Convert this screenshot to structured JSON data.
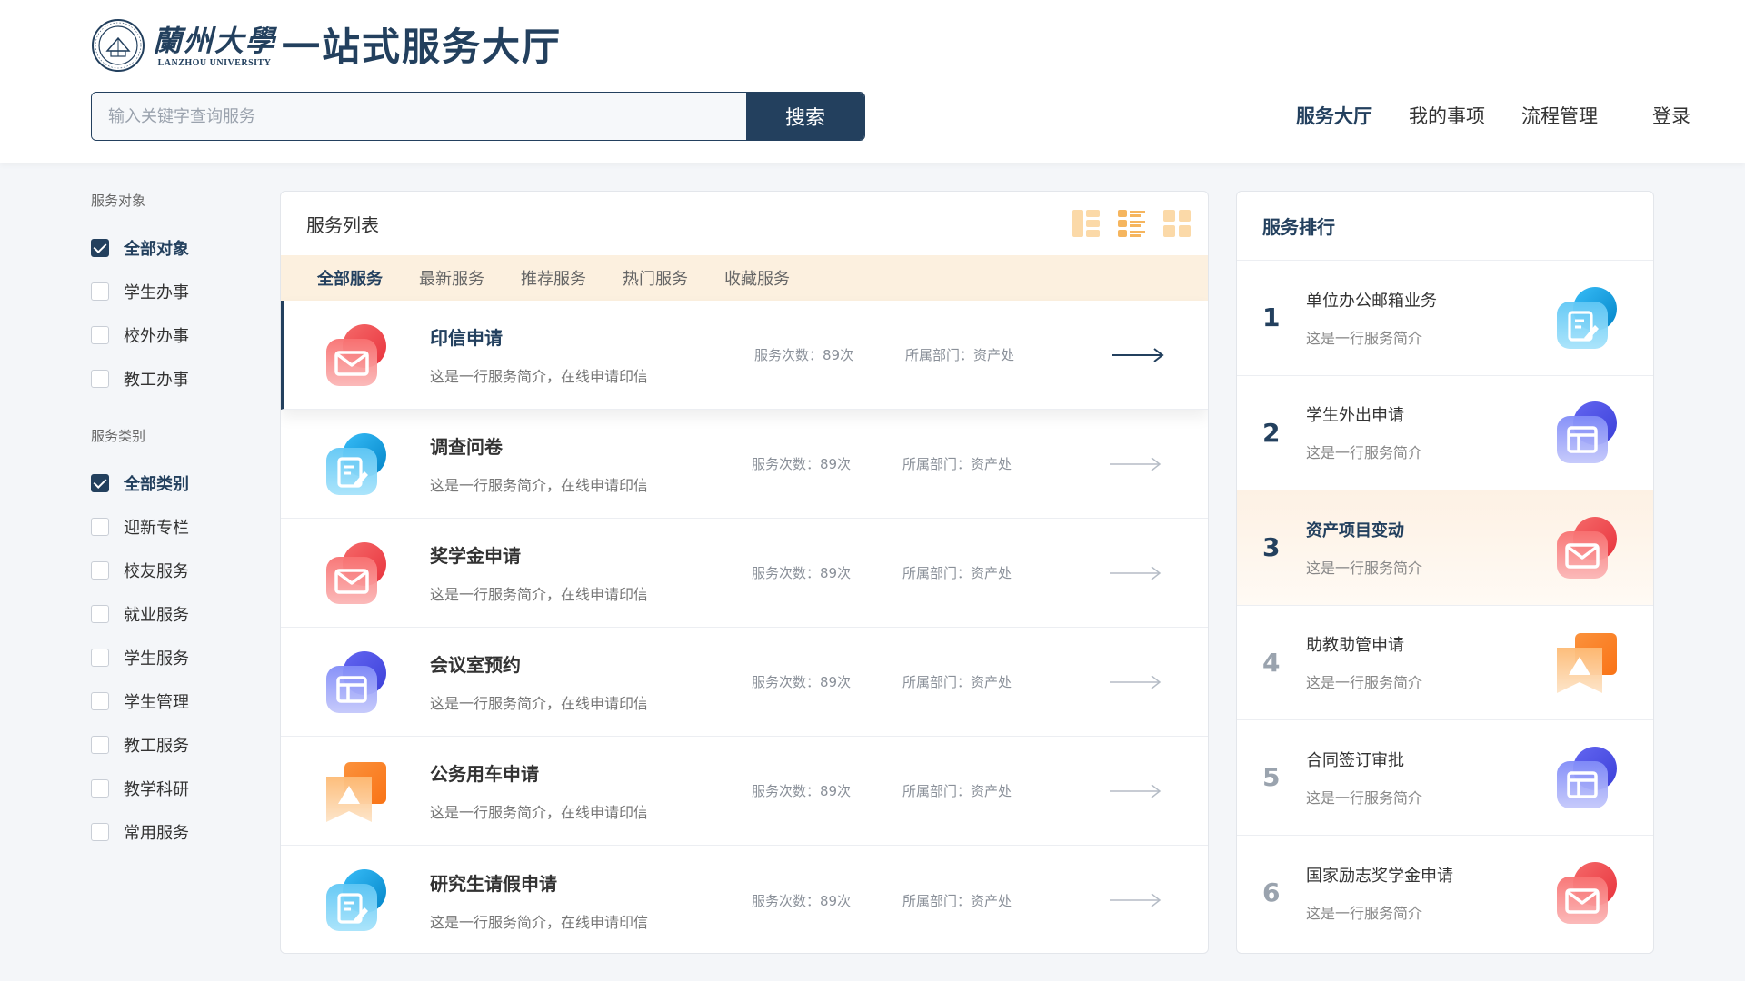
{
  "header": {
    "university_cn": "蘭州大學",
    "university_en": "LANZHOU UNIVERSITY",
    "site_title": "一站式服务大厅",
    "search_placeholder": "输入关键字查询服务",
    "search_button": "搜索",
    "nav": [
      {
        "label": "服务大厅",
        "active": true
      },
      {
        "label": "我的事项",
        "active": false
      },
      {
        "label": "流程管理",
        "active": false
      }
    ],
    "login": "登录"
  },
  "sidebar": {
    "target_title": "服务对象",
    "targets": [
      {
        "label": "全部对象",
        "checked": true
      },
      {
        "label": "学生办事",
        "checked": false
      },
      {
        "label": "校外办事",
        "checked": false
      },
      {
        "label": "教工办事",
        "checked": false
      }
    ],
    "category_title": "服务类别",
    "categories": [
      {
        "label": "全部类别",
        "checked": true
      },
      {
        "label": "迎新专栏",
        "checked": false
      },
      {
        "label": "校友服务",
        "checked": false
      },
      {
        "label": "就业服务",
        "checked": false
      },
      {
        "label": "学生服务",
        "checked": false
      },
      {
        "label": "学生管理",
        "checked": false
      },
      {
        "label": "教工服务",
        "checked": false
      },
      {
        "label": "教学科研",
        "checked": false
      },
      {
        "label": "常用服务",
        "checked": false
      }
    ]
  },
  "service_list": {
    "title": "服务列表",
    "tabs": [
      "全部服务",
      "最新服务",
      "推荐服务",
      "热门服务",
      "收藏服务"
    ],
    "items": [
      {
        "name": "印信申请",
        "desc": "这是一行服务简介，在线申请印信",
        "count": "服务次数：89次",
        "dept": "所属部门：资产处",
        "icon": "mail-icon"
      },
      {
        "name": "调查问卷",
        "desc": "这是一行服务简介，在线申请印信",
        "count": "服务次数：89次",
        "dept": "所属部门：资产处",
        "icon": "edit-document-icon"
      },
      {
        "name": "奖学金申请",
        "desc": "这是一行服务简介，在线申请印信",
        "count": "服务次数：89次",
        "dept": "所属部门：资产处",
        "icon": "mail-icon"
      },
      {
        "name": "会议室预约",
        "desc": "这是一行服务简介，在线申请印信",
        "count": "服务次数：89次",
        "dept": "所属部门：资产处",
        "icon": "layout-icon"
      },
      {
        "name": "公务用车申请",
        "desc": "这是一行服务简介，在线申请印信",
        "count": "服务次数：89次",
        "dept": "所属部门：资产处",
        "icon": "ribbon-icon"
      },
      {
        "name": "研究生请假申请",
        "desc": "这是一行服务简介，在线申请印信",
        "count": "服务次数：89次",
        "dept": "所属部门：资产处",
        "icon": "edit-document-icon"
      }
    ]
  },
  "ranking": {
    "title": "服务排行",
    "items": [
      {
        "rank": "1",
        "name": "单位办公邮箱业务",
        "desc": "这是一行服务简介",
        "icon": "edit-document-icon"
      },
      {
        "rank": "2",
        "name": "学生外出申请",
        "desc": "这是一行服务简介",
        "icon": "layout-icon"
      },
      {
        "rank": "3",
        "name": "资产项目变动",
        "desc": "这是一行服务简介",
        "icon": "mail-icon"
      },
      {
        "rank": "4",
        "name": "助教助管申请",
        "desc": "这是一行服务简介",
        "icon": "ribbon-icon"
      },
      {
        "rank": "5",
        "name": "合同签订审批",
        "desc": "这是一行服务简介",
        "icon": "layout-icon"
      },
      {
        "rank": "6",
        "name": "国家励志奖学金申请",
        "desc": "这是一行服务简介",
        "icon": "mail-icon"
      }
    ]
  },
  "colors": {
    "primary": "#23405e",
    "tab_bar": "#fcf0df",
    "highlight_row": "#fdf1e4"
  }
}
